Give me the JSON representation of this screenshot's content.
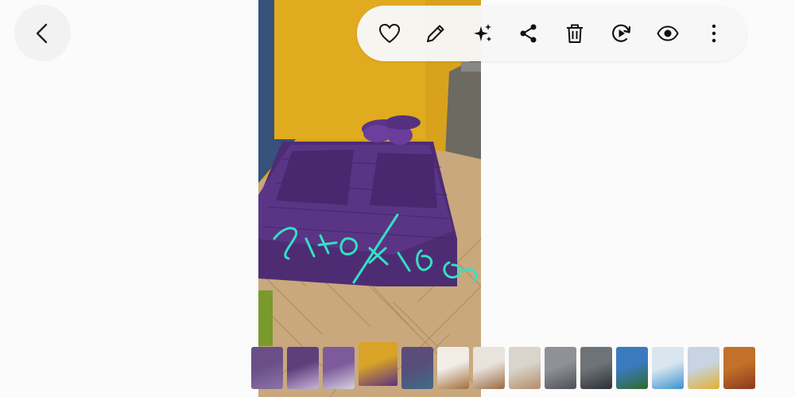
{
  "nav": {
    "back_icon": "chevron-left-icon"
  },
  "toolbar": {
    "actions": [
      {
        "name": "favorite-button",
        "icon": "heart-icon"
      },
      {
        "name": "edit-button",
        "icon": "pencil-icon"
      },
      {
        "name": "ai-enhance-button",
        "icon": "sparkles-icon"
      },
      {
        "name": "share-button",
        "icon": "share-icon"
      },
      {
        "name": "delete-button",
        "icon": "trash-icon"
      },
      {
        "name": "remaster-button",
        "icon": "play-refresh-icon"
      },
      {
        "name": "view-button",
        "icon": "eye-icon"
      },
      {
        "name": "more-options-button",
        "icon": "more-vertical-icon"
      }
    ]
  },
  "photo": {
    "description_icon": "bedroom-photo",
    "handwriting": "140x160",
    "handwriting_color": "#34e0c4"
  },
  "filmstrip": {
    "selected_index": 3,
    "thumbnails": [
      {
        "name": "thumb-purple-fabric",
        "colors": [
          "#6a4f86",
          "#8b74a8"
        ]
      },
      {
        "name": "thumb-purple-pillows",
        "colors": [
          "#5e3f7c",
          "#c9b3d8"
        ]
      },
      {
        "name": "thumb-purple-cushions",
        "colors": [
          "#7c5a9b",
          "#d8d0e0"
        ]
      },
      {
        "name": "thumb-bed-selected",
        "colors": [
          "#d8a326",
          "#5c2f86"
        ]
      },
      {
        "name": "thumb-purple-bedding",
        "colors": [
          "#5a4d7a",
          "#3d6c86"
        ]
      },
      {
        "name": "thumb-coffee-cup-1",
        "colors": [
          "#f1ede6",
          "#a26e3c"
        ]
      },
      {
        "name": "thumb-coffee-cup-2",
        "colors": [
          "#e8e3dc",
          "#9b6a42"
        ]
      },
      {
        "name": "thumb-coffee-cup-3",
        "colors": [
          "#d9d4cc",
          "#b48c68"
        ]
      },
      {
        "name": "thumb-washing-machine-1",
        "colors": [
          "#8e9296",
          "#4d5156"
        ]
      },
      {
        "name": "thumb-washing-machine-2",
        "colors": [
          "#6e7378",
          "#2c3034"
        ]
      },
      {
        "name": "thumb-people-outdoors",
        "colors": [
          "#3c7ac0",
          "#2f6a2a"
        ]
      },
      {
        "name": "thumb-product-box",
        "colors": [
          "#d9e6ef",
          "#3a92d0"
        ]
      },
      {
        "name": "thumb-shelf-items",
        "colors": [
          "#c8d4e2",
          "#e0b030"
        ]
      },
      {
        "name": "thumb-store-display",
        "colors": [
          "#c2702a",
          "#8a3a20"
        ]
      }
    ]
  }
}
